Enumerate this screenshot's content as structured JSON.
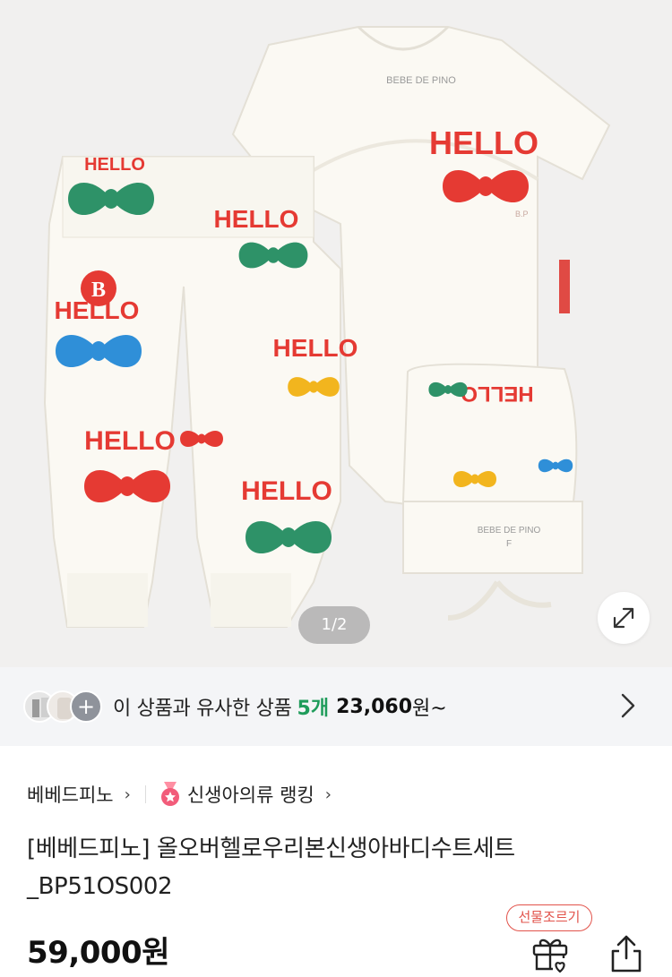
{
  "gallery": {
    "counter": "1/2",
    "print_text": "HELLO",
    "label_text": "BEBE DE PINO",
    "size_text": "F",
    "initials": "B.P",
    "badge_letter": "B"
  },
  "similar": {
    "text": "이 상품과 유사한 상품",
    "count": "5개",
    "price": "23,060",
    "suffix": "원~",
    "plus_glyph": "+"
  },
  "breadcrumb": {
    "brand": "베베드피노",
    "ranking": "신생아의류 랭킹",
    "chevron": "›"
  },
  "product": {
    "title": "[베베드피노] 올오버헬로우리본신생아바디수트세트_BP51OS002",
    "price": "59,000원",
    "gift_label": "선물조르기"
  },
  "colors": {
    "accent_green": "#1f9c5b",
    "gift_red": "#e2534b",
    "bow_red": "#e53a33",
    "bow_green": "#2e9268",
    "bow_blue": "#2f8fd8",
    "bow_yellow": "#f2b51e"
  },
  "icons": [
    "expand-icon",
    "chevron-right-icon",
    "medal-icon",
    "gift-icon",
    "share-icon"
  ]
}
